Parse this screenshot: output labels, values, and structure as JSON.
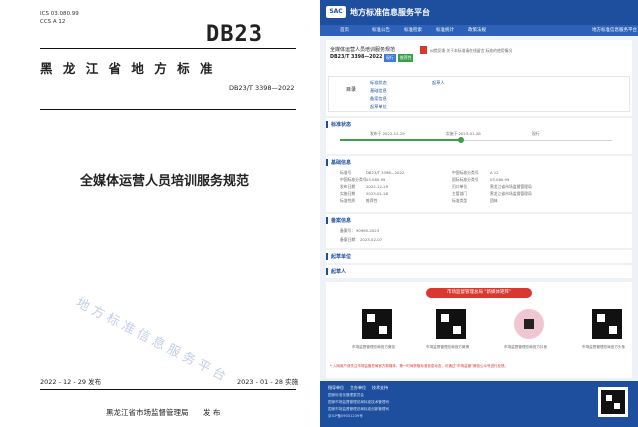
{
  "document": {
    "ics": "ICS 03.080.99",
    "ccs": "CCS A 12",
    "logo": "DB23",
    "region_title": "黑 龙 江 省 地 方 标 准",
    "code": "DB23/T 3398—2022",
    "title": "全媒体运营人员培训服务规范",
    "watermark": "地方标准信息服务平台",
    "issue_date": "2022 - 12 - 29 发布",
    "impl_date": "2023 - 01 - 28 实施",
    "issuer": "黑龙江省市场监督管理局",
    "issuer_suffix": "发 布"
  },
  "portal": {
    "logo_badge": "SAC",
    "site_title": "地方标准信息服务平台",
    "header_right": "地方标准信息服务平台",
    "nav": [
      "首页",
      "标准公告",
      "标准检索",
      "标准统计",
      "政策法规"
    ],
    "std_title": "全媒体运营人员培训服务规范",
    "std_code": "DB23/T 3398—2022",
    "badge_current": "现行",
    "badge_tag": "推荐性",
    "toolbar_note": "纠错反馈 关于本标准请在线留言 标准的使用情况",
    "toc_label": "目录",
    "toc_items": [
      "标准状态",
      "基础信息",
      "备案信息",
      "起草单位"
    ],
    "toc_right": "起草人",
    "status_section": "标准状态",
    "status_issue": "发布于 2022-12-29",
    "status_impl": "实施于 2023-01-28",
    "status_now": "现行",
    "basic_section": "基础信息",
    "basic_left": [
      [
        "标准号",
        "DB23/T 3398—2022"
      ],
      [
        "中国标准分类号",
        "03.080.99"
      ],
      [
        "发布日期",
        "2022-12-29"
      ],
      [
        "实施日期",
        "2023-01-28"
      ],
      [
        "标准性质",
        "推荐性"
      ]
    ],
    "basic_right": [
      [
        "中国标准分类号",
        "A 12"
      ],
      [
        "国际标准分类号",
        "03.080.99"
      ],
      [
        "归口单位",
        "黑龙江省市场监督管理局"
      ],
      [
        "主管部门",
        "黑龙江省市场监督管理局"
      ],
      [
        "标准类型",
        "团体"
      ]
    ],
    "filing_section": "备案信息",
    "filing_no_label": "备案号：",
    "filing_no": "90965-2023",
    "filing_date_label": "备案日期：",
    "filing_date": "2023-02-07",
    "drafter_unit_section": "起草单位",
    "drafter_section": "起草人",
    "promo_banner": "市场监督管理总局 \"新媒体矩阵\"",
    "qr_captions": [
      "市场监督管理总局官方微信",
      "市场监督管理总局官方微博",
      "市场监督管理总局官方抖音",
      "市场监督管理总局官方头条"
    ],
    "footer_note": "* 入网用户请关注市场监管总局官方新媒体，第一时间获取标准信息动态，可通过“市场监管”微信公众号进行反馈。",
    "footer_cols": [
      "指导单位",
      "主办单位",
      "技术支持"
    ],
    "footer_lines": [
      "国家标准化管理委员会",
      "国家市场监督管理总局标准技术管理司",
      "国家市场监督管理总局标准创新管理司",
      "京ICP备09001239号"
    ],
    "colors": {
      "brand": "#1e4f9e",
      "banner": "#d9372f",
      "badge_green": "#3aa14a",
      "badge_blue": "#3e7bd6"
    }
  }
}
